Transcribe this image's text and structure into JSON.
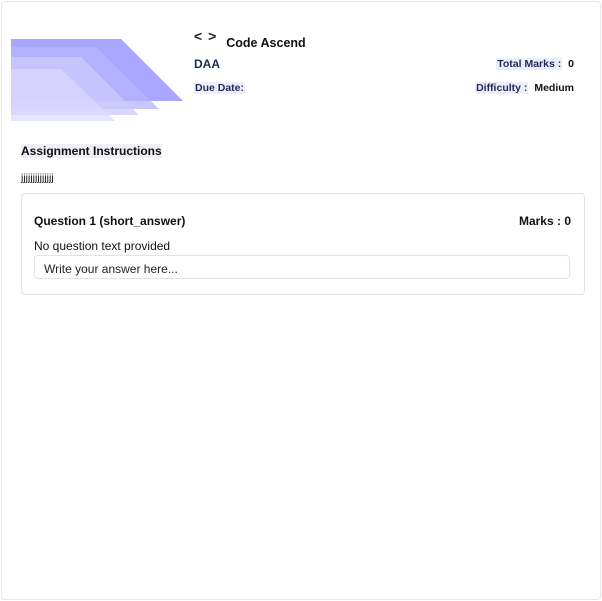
{
  "brand": {
    "icon": "code-icon",
    "name": "Code Ascend"
  },
  "assignment": {
    "course": "DAA",
    "due_label": "Due Date:",
    "due_value": "",
    "total_marks_label": "Total Marks :",
    "total_marks_value": "0",
    "difficulty_label": "Difficulty :",
    "difficulty_value": "Medium"
  },
  "instructions": {
    "title": "Assignment Instructions",
    "text": "jjjjjjjjjjjjjj"
  },
  "questions": [
    {
      "title": "Question 1 (short_answer)",
      "marks": "Marks : 0",
      "text": "No question  text provided",
      "answer_placeholder": "Write your answer here..."
    }
  ],
  "colors": {
    "banner_dark": "#8c88ff",
    "banner_light": "#c9c5fb",
    "heading": "#1e2a5a"
  }
}
